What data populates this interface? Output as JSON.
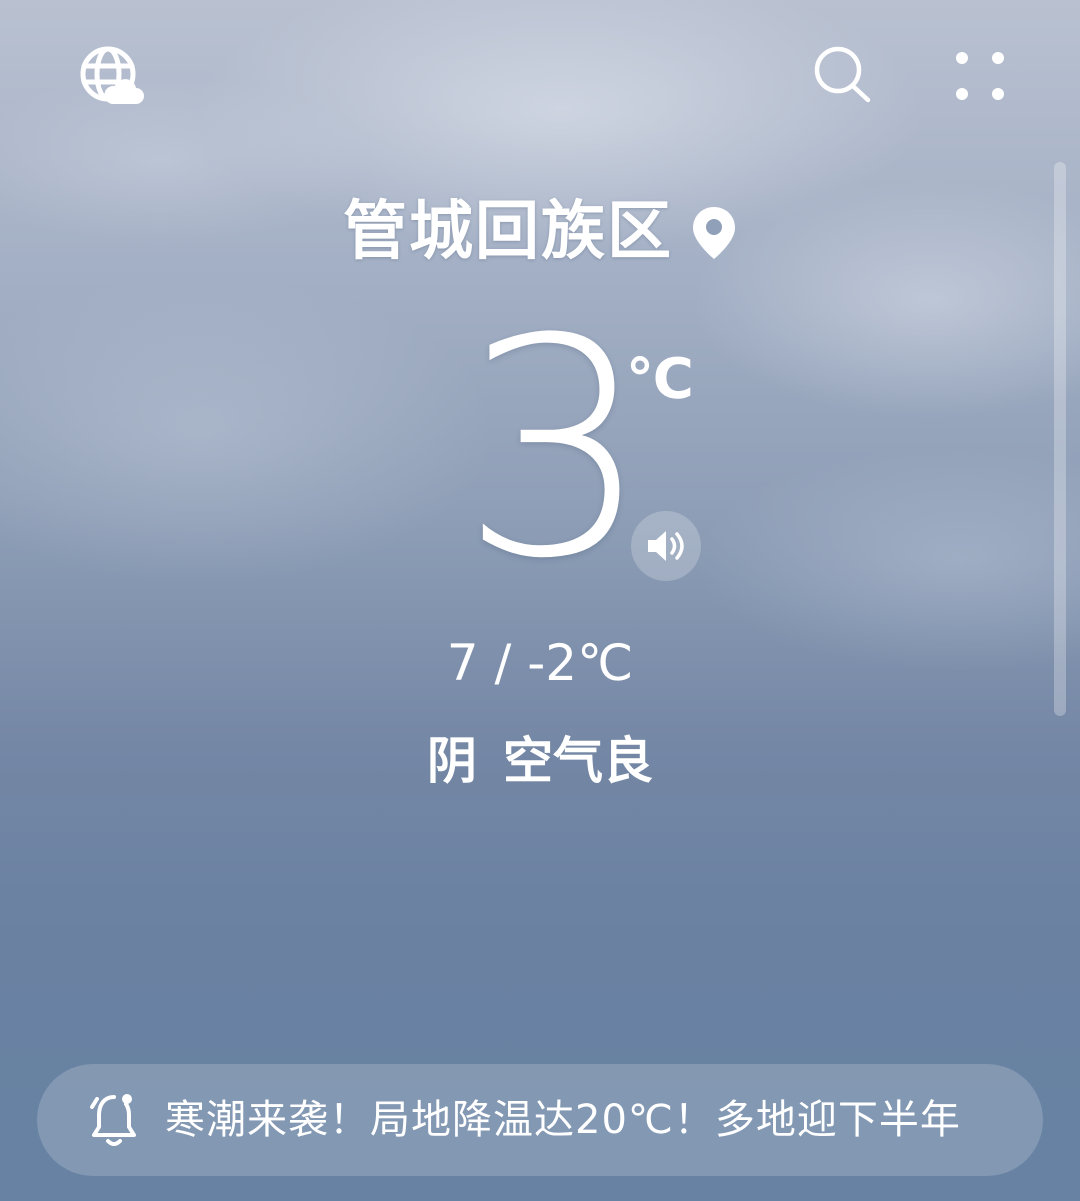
{
  "header": {
    "left_icon": "globe-cloud-icon",
    "search_icon": "search-icon",
    "more_icon": "more-grid-icon"
  },
  "location": {
    "name": "管城回族区",
    "pin_icon": "location-pin-icon"
  },
  "current": {
    "temperature": "3",
    "unit": "℃",
    "speaker_icon": "speaker-icon"
  },
  "range": {
    "text": "7 / -2℃"
  },
  "condition": {
    "weather": "阴",
    "air_quality": "空气良"
  },
  "alert": {
    "icon": "bell-icon",
    "text": "寒潮来袭！局地降温达20℃！多地迎下半年"
  },
  "colors": {
    "sky_top": "#b9c1d1",
    "sky_bottom": "#6782a3",
    "text": "#ffffff"
  }
}
